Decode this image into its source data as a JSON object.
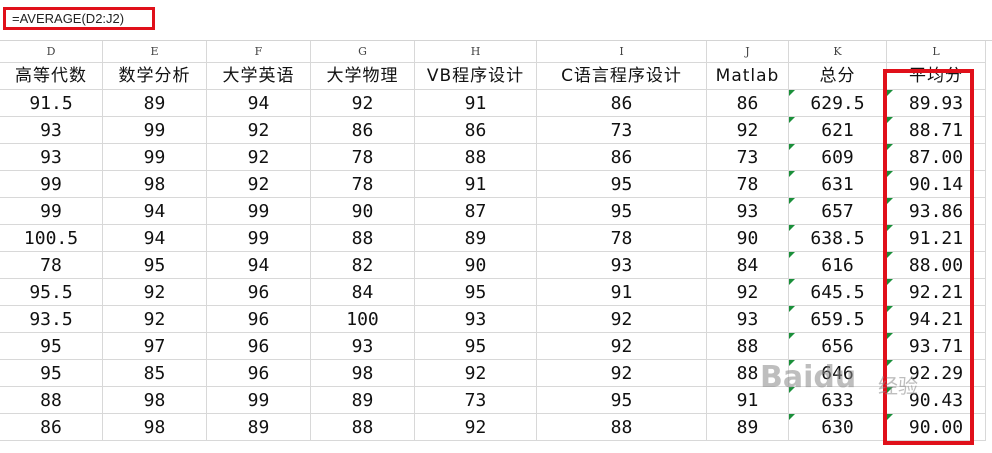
{
  "formula_bar": {
    "formula": "=AVERAGE(D2:J2)"
  },
  "columns": [
    "D",
    "E",
    "F",
    "G",
    "H",
    "I",
    "J",
    "K",
    "L"
  ],
  "headers": [
    "高等代数",
    "数学分析",
    "大学英语",
    "大学物理",
    "VB程序设计",
    "C语言程序设计",
    "Matlab",
    "总分",
    "平均分"
  ],
  "rows": [
    [
      "91.5",
      "89",
      "94",
      "92",
      "91",
      "86",
      "86",
      "629.5",
      "89.93"
    ],
    [
      "93",
      "99",
      "92",
      "86",
      "86",
      "73",
      "92",
      "621",
      "88.71"
    ],
    [
      "93",
      "99",
      "92",
      "78",
      "88",
      "86",
      "73",
      "609",
      "87.00"
    ],
    [
      "99",
      "98",
      "92",
      "78",
      "91",
      "95",
      "78",
      "631",
      "90.14"
    ],
    [
      "99",
      "94",
      "99",
      "90",
      "87",
      "95",
      "93",
      "657",
      "93.86"
    ],
    [
      "100.5",
      "94",
      "99",
      "88",
      "89",
      "78",
      "90",
      "638.5",
      "91.21"
    ],
    [
      "78",
      "95",
      "94",
      "82",
      "90",
      "93",
      "84",
      "616",
      "88.00"
    ],
    [
      "95.5",
      "92",
      "96",
      "84",
      "95",
      "91",
      "92",
      "645.5",
      "92.21"
    ],
    [
      "93.5",
      "92",
      "96",
      "100",
      "93",
      "92",
      "93",
      "659.5",
      "94.21"
    ],
    [
      "95",
      "97",
      "96",
      "93",
      "95",
      "92",
      "88",
      "656",
      "93.71"
    ],
    [
      "95",
      "85",
      "96",
      "98",
      "92",
      "92",
      "88",
      "646",
      "92.29"
    ],
    [
      "88",
      "98",
      "99",
      "89",
      "73",
      "95",
      "91",
      "633",
      "90.43"
    ],
    [
      "86",
      "98",
      "89",
      "88",
      "92",
      "88",
      "89",
      "630",
      "90.00"
    ]
  ],
  "watermark": {
    "logo": "Baidu",
    "sub": "经验"
  },
  "colors": {
    "highlight": "#e0101a",
    "error_triangle": "#1a8f3a"
  }
}
